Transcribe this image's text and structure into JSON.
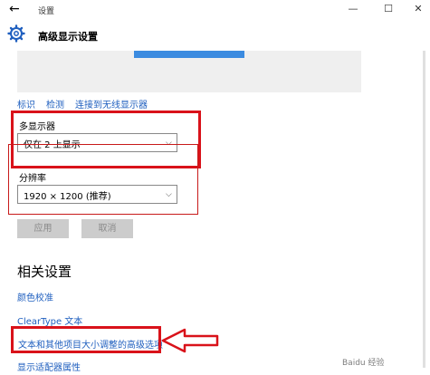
{
  "window": {
    "title": "设置",
    "minimize": "—",
    "maximize": "☐",
    "close": "✕"
  },
  "header": {
    "title": "高级显示设置"
  },
  "links_top": [
    "标识",
    "检测",
    "连接到无线显示器"
  ],
  "multi_display": {
    "label": "多显示器",
    "selected": "仅在 2 上显示"
  },
  "resolution": {
    "label": "分辨率",
    "selected": "1920 × 1200 (推荐)"
  },
  "buttons": {
    "apply": "应用",
    "cancel": "取消"
  },
  "related": {
    "title": "相关设置",
    "links": [
      "颜色校准",
      "ClearType 文本",
      "文本和其他项目大小调整的高级选项",
      "显示适配器属性"
    ]
  },
  "watermark": "Baidu 经验",
  "colors": {
    "link": "#1f5fbf",
    "highlight": "#d9121a",
    "accent": "#3b8be0"
  }
}
